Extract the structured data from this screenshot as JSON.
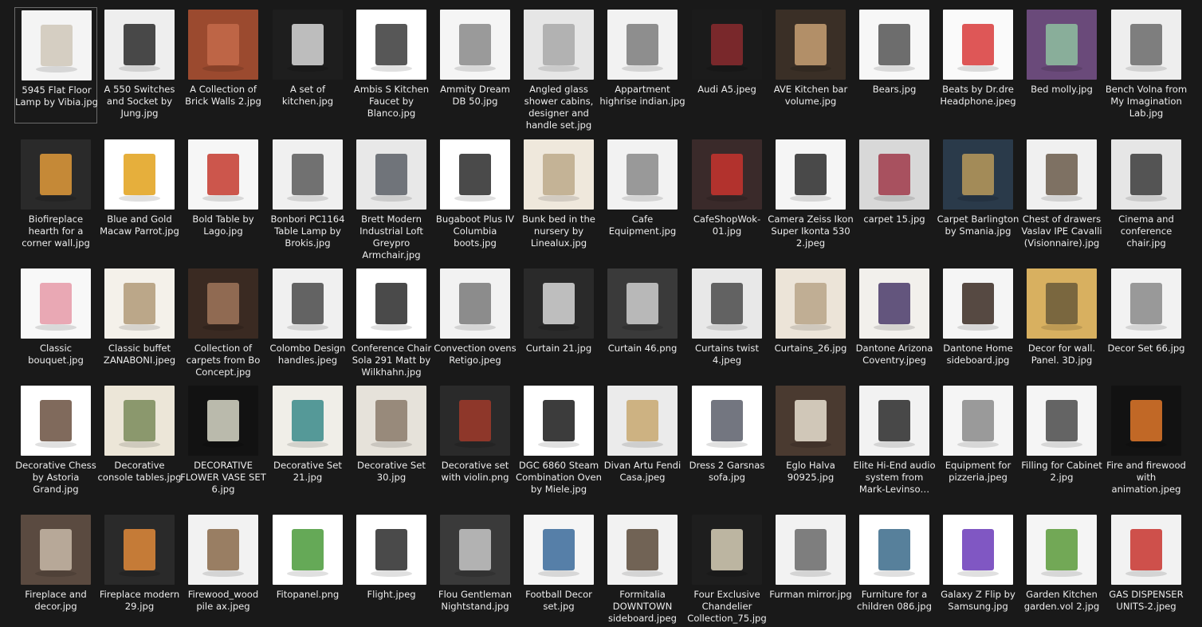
{
  "items": [
    {
      "label": "5945 Flat Floor Lamp by Vibia.jpg",
      "bg": "#f4f4f4",
      "fg": "#cfc7b8",
      "icon": "floor-lamp-icon"
    },
    {
      "label": "A 550 Switches and Socket by Jung.jpg",
      "bg": "#eeeeee",
      "fg": "#2a2a2a",
      "icon": "socket-icon"
    },
    {
      "label": "A Collection of Brick Walls 2.jpg",
      "bg": "#9b4a2f",
      "fg": "#c46a4a",
      "icon": "brick-icon"
    },
    {
      "label": "A set of kitchen.jpg",
      "bg": "#1e1e1e",
      "fg": "#d9d9d9",
      "icon": "kitchen-icon"
    },
    {
      "label": "Ambis S Kitchen Faucet by Blanco.jpg",
      "bg": "#ffffff",
      "fg": "#3a3a3a",
      "icon": "faucet-icon"
    },
    {
      "label": "Ammity Dream DB 50.jpg",
      "bg": "#f5f5f5",
      "fg": "#8a8a8a",
      "icon": "bike-icon"
    },
    {
      "label": "Angled glass shower cabins, designer and handle set.jpg",
      "bg": "#e6e6e6",
      "fg": "#a8a8a8",
      "icon": "shower-icon"
    },
    {
      "label": "Appartment highrise indian.jpg",
      "bg": "#f2f2f2",
      "fg": "#7d7d7d",
      "icon": "building-icon"
    },
    {
      "label": "Audi A5.jpeg",
      "bg": "#1b1b1b",
      "fg": "#8a2a2e",
      "icon": "car-icon"
    },
    {
      "label": "AVE Kitchen bar volume.jpg",
      "bg": "#3a2f26",
      "fg": "#c8a074",
      "icon": "bar-icon"
    },
    {
      "label": "Bears.jpg",
      "bg": "#f7f7f7",
      "fg": "#555555",
      "icon": "bear-icon"
    },
    {
      "label": "Beats by Dr.dre Headphone.jpeg",
      "bg": "#fafafa",
      "fg": "#d83a3a",
      "icon": "headphone-icon"
    },
    {
      "label": "Bed molly.jpg",
      "bg": "#6a4a7a",
      "fg": "#8ec0a0",
      "icon": "bed-icon"
    },
    {
      "label": "Bench Volna from My Imagination Lab.jpg",
      "bg": "#eeeeee",
      "fg": "#6a6a6a",
      "icon": "bench-icon"
    },
    {
      "label": "Biofireplace hearth for a corner wall.jpg",
      "bg": "#2a2a2a",
      "fg": "#e09a3a",
      "icon": "fireplace-icon"
    },
    {
      "label": "Blue and Gold Macaw Parrot.jpg",
      "bg": "#ffffff",
      "fg": "#e2a11a",
      "icon": "parrot-icon"
    },
    {
      "label": "Bold Table by Lago.jpg",
      "bg": "#f6f6f6",
      "fg": "#c43a2e",
      "icon": "table-icon"
    },
    {
      "label": "Bonbori PC1164 Table Lamp by Brokis.jpg",
      "bg": "#f0f0f0",
      "fg": "#5a5a5a",
      "icon": "lamp-icon"
    },
    {
      "label": "Brett Modern Industrial Loft Greypro Armchair.jpg",
      "bg": "#e8e8e8",
      "fg": "#5b5f66",
      "icon": "armchair-icon"
    },
    {
      "label": "Bugaboot Plus IV Columbia boots.jpg",
      "bg": "#ffffff",
      "fg": "#2a2a2a",
      "icon": "boot-icon"
    },
    {
      "label": "Bunk bed in the nursery by Linealux.jpg",
      "bg": "#efe8dc",
      "fg": "#bca98a",
      "icon": "bunk-bed-icon"
    },
    {
      "label": "Cafe Equipment.jpg",
      "bg": "#f2f2f2",
      "fg": "#8a8a8a",
      "icon": "cafe-icon"
    },
    {
      "label": "CafeShopWok-01.jpg",
      "bg": "#3a2a2a",
      "fg": "#c8342e",
      "icon": "shop-icon"
    },
    {
      "label": "Camera Zeiss Ikon Super Ikonta 530 2.jpeg",
      "bg": "#f5f5f5",
      "fg": "#2a2a2a",
      "icon": "camera-icon"
    },
    {
      "label": "carpet 15.jpg",
      "bg": "#d8d8d8",
      "fg": "#a03a4a",
      "icon": "carpet-icon"
    },
    {
      "label": "Carpet Barlington by Smania.jpg",
      "bg": "#2a3a4a",
      "fg": "#b89a5a",
      "icon": "carpet-icon"
    },
    {
      "label": "Chest of drawers Vaslav IPE Cavalli (Visionnaire).jpg",
      "bg": "#f0f0f0",
      "fg": "#6a5a4a",
      "icon": "drawers-icon"
    },
    {
      "label": "Cinema and conference chair.jpg",
      "bg": "#e6e6e6",
      "fg": "#3a3a3a",
      "icon": "chair-icon"
    },
    {
      "label": "Classic bouquet.jpg",
      "bg": "#f8f8f8",
      "fg": "#e69aa8",
      "icon": "flower-icon"
    },
    {
      "label": "Classic buffet ZANABONI.jpeg",
      "bg": "#f4f1ea",
      "fg": "#b09a78",
      "icon": "buffet-icon"
    },
    {
      "label": "Collection of carpets from Bo Concept.jpg",
      "bg": "#3a2a22",
      "fg": "#a0765a",
      "icon": "carpet-icon"
    },
    {
      "label": "Colombo Design handles.jpeg",
      "bg": "#f0f0f0",
      "fg": "#4a4a4a",
      "icon": "handle-icon"
    },
    {
      "label": "Conference Chair Sola 291 Matt by Wilkhahn.jpg",
      "bg": "#ffffff",
      "fg": "#2a2a2a",
      "icon": "office-chair-icon"
    },
    {
      "label": "Convection ovens Retigo.jpeg",
      "bg": "#f2f2f2",
      "fg": "#7a7a7a",
      "icon": "oven-icon"
    },
    {
      "label": "Curtain 21.jpg",
      "bg": "#2a2a2a",
      "fg": "#d8d8d8",
      "icon": "curtain-icon"
    },
    {
      "label": "Curtain 46.png",
      "bg": "#3a3a3a",
      "fg": "#cfcfcf",
      "icon": "curtain-icon"
    },
    {
      "label": "Curtains twist 4.jpeg",
      "bg": "#e8e8e8",
      "fg": "#4a4a4a",
      "icon": "curtain-icon"
    },
    {
      "label": "Curtains_26.jpg",
      "bg": "#ece4d8",
      "fg": "#b8a488",
      "icon": "curtain-icon"
    },
    {
      "label": "Dantone Arizona Coventry.jpeg",
      "bg": "#f2f0ec",
      "fg": "#4a3a6a",
      "icon": "dining-icon"
    },
    {
      "label": "Dantone Home sideboard.jpg",
      "bg": "#f5f5f5",
      "fg": "#3a2a22",
      "icon": "sideboard-icon"
    },
    {
      "label": "Decor for wall. Panel. 3D.jpg",
      "bg": "#d8b060",
      "fg": "#6a5a3a",
      "icon": "panel-icon"
    },
    {
      "label": "Decor Set 66.jpg",
      "bg": "#f2f2f2",
      "fg": "#8a8a8a",
      "icon": "decor-icon"
    },
    {
      "label": "Decorative Chess by Astoria Grand.jpg",
      "bg": "#ffffff",
      "fg": "#6a5040",
      "icon": "chess-icon"
    },
    {
      "label": "Decorative console tables.jpg",
      "bg": "#ece6d8",
      "fg": "#7a8a5a",
      "icon": "console-icon"
    },
    {
      "label": "DECORATIVE FLOWER VASE SET 6.jpg",
      "bg": "#121212",
      "fg": "#d8d8c8",
      "icon": "vase-icon"
    },
    {
      "label": "Decorative Set 21.jpg",
      "bg": "#f0eee8",
      "fg": "#3a8a8a",
      "icon": "decor-icon"
    },
    {
      "label": "Decorative Set 30.jpg",
      "bg": "#e6e2da",
      "fg": "#8a7a6a",
      "icon": "decor-icon"
    },
    {
      "label": "Decorative set with violin.png",
      "bg": "#2a2a2a",
      "fg": "#a03a2a",
      "icon": "violin-icon"
    },
    {
      "label": "DGC 6860 Steam Combination Oven by Miele.jpg",
      "bg": "#ffffff",
      "fg": "#1a1a1a",
      "icon": "oven-icon"
    },
    {
      "label": "Divan Artu Fendi Casa.jpeg",
      "bg": "#ebebeb",
      "fg": "#c8a870",
      "icon": "sofa-icon"
    },
    {
      "label": "Dress 2 Garsnas sofa.jpg",
      "bg": "#ffffff",
      "fg": "#5a5e6a",
      "icon": "sofa-icon"
    },
    {
      "label": "Eglo Halva 90925.jpg",
      "bg": "#4a3a30",
      "fg": "#e8e0d0",
      "icon": "sconce-icon"
    },
    {
      "label": "Elite Hi-End audio system from Mark-Levinso…",
      "bg": "#f2f2f2",
      "fg": "#2a2a2a",
      "icon": "speaker-icon"
    },
    {
      "label": "Equipment for pizzeria.jpeg",
      "bg": "#f5f5f5",
      "fg": "#8a8a8a",
      "icon": "pizzeria-icon"
    },
    {
      "label": "Filling for Cabinet 2.jpg",
      "bg": "#f5f5f5",
      "fg": "#4a4a4a",
      "icon": "cabinet-icon"
    },
    {
      "label": "Fire and firewood with animation.jpeg",
      "bg": "#121212",
      "fg": "#e0782a",
      "icon": "fire-icon"
    },
    {
      "label": "Fireplace and decor.jpg",
      "bg": "#5a4a40",
      "fg": "#c8b8a8",
      "icon": "fireplace-icon"
    },
    {
      "label": "Fireplace modern 29.jpg",
      "bg": "#2a2a2a",
      "fg": "#e08a3a",
      "icon": "fireplace-icon"
    },
    {
      "label": "Firewood_wood pile ax.jpeg",
      "bg": "#f2f2f2",
      "fg": "#8a6a4a",
      "icon": "firewood-icon"
    },
    {
      "label": "Fitopanel.png",
      "bg": "#ffffff",
      "fg": "#4a9a3a",
      "icon": "plant-icon"
    },
    {
      "label": "Flight.jpeg",
      "bg": "#ffffff",
      "fg": "#2a2a2a",
      "icon": "flight-icon"
    },
    {
      "label": "Flou Gentleman Nightstand.jpg",
      "bg": "#3a3a3a",
      "fg": "#c8c8c8",
      "icon": "nightstand-icon"
    },
    {
      "label": "Football Decor set.jpg",
      "bg": "#f5f5f5",
      "fg": "#3a6a9a",
      "icon": "football-icon"
    },
    {
      "label": "Formitalia DOWNTOWN sideboard.jpeg",
      "bg": "#f2f2f2",
      "fg": "#5a4a3a",
      "icon": "sideboard-icon"
    },
    {
      "label": "Four Exclusive Chandelier Collection_75.jpg",
      "bg": "#1e1e1e",
      "fg": "#d8d0b8",
      "icon": "chandelier-icon"
    },
    {
      "label": "Furman mirror.jpg",
      "bg": "#f2f2f2",
      "fg": "#6a6a6a",
      "icon": "mirror-icon"
    },
    {
      "label": "Furniture for a children 086.jpg",
      "bg": "#ffffff",
      "fg": "#3a6a8a",
      "icon": "shelf-icon"
    },
    {
      "label": "Galaxy Z Flip by Samsung.jpg",
      "bg": "#ffffff",
      "fg": "#6a3ab8",
      "icon": "phone-icon"
    },
    {
      "label": "Garden Kitchen garden.vol 2.jpg",
      "bg": "#f5f5f5",
      "fg": "#5a9a3a",
      "icon": "garden-icon"
    },
    {
      "label": "GAS DISPENSER UNITS-2.jpeg",
      "bg": "#f2f2f2",
      "fg": "#c8342e",
      "icon": "gas-pump-icon"
    }
  ]
}
